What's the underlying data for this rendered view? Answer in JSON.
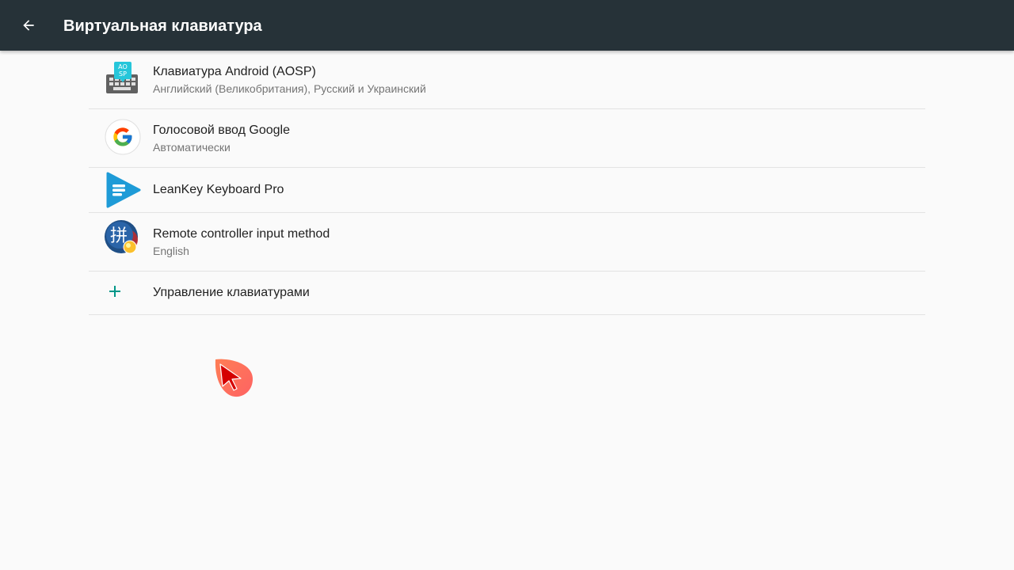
{
  "appbar": {
    "back_icon": "arrow-left-icon",
    "title": "Виртуальная клавиатура",
    "background": "#263238"
  },
  "keyboards": [
    {
      "icon": "aosp-keyboard-icon",
      "title": "Клавиатура Android (AOSP)",
      "subtitle": "Английский (Великобритания), Русский и Украинский"
    },
    {
      "icon": "google-g-icon",
      "title": "Голосовой ввод Google",
      "subtitle": "Автоматически"
    },
    {
      "icon": "leankey-play-icon",
      "title": "LeanKey Keyboard Pro"
    },
    {
      "icon": "remote-controller-pinyin-icon",
      "title": "Remote controller input method",
      "subtitle": "English"
    }
  ],
  "manage": {
    "icon": "plus-icon",
    "label": "Управление клавиатурами",
    "accent": "#009688"
  },
  "pointer": {
    "icon": "mouse-pointer-icon",
    "color": "#e53935"
  }
}
